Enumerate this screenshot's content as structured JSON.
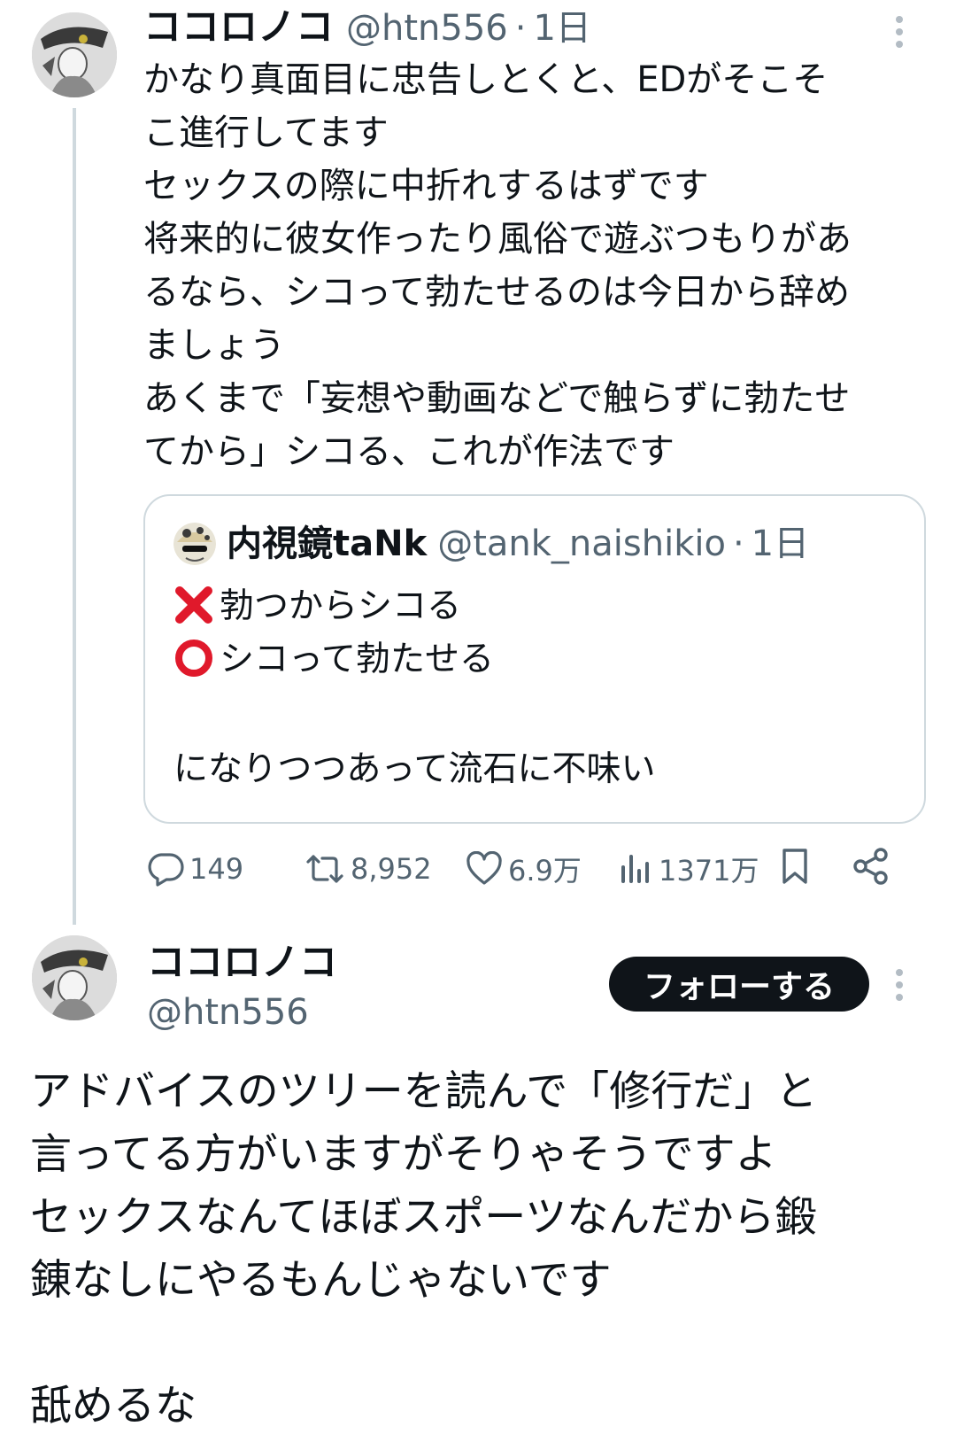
{
  "parent_tweet": {
    "author_name": "ココロノコ",
    "handle": "@htn556",
    "time": "1日",
    "text": "かなり真面目に忠告しとくと、EDがそこそ\nこ進行してます\nセックスの際に中折れするはずです\n将来的に彼女作ったり風俗で遊ぶつもりがあ\nるなら、シコって勃たせるのは今日から辞め\nましょう\nあくまで「妄想や動画などで触らずに勃たせ\nてから」シコる、これが作法です",
    "quote": {
      "author_name": "内視鏡taNk",
      "handle": "@tank_naishikio",
      "time": "1日",
      "line1": "勃つからシコる",
      "line2": "シコって勃たせる",
      "line3": "になりつつあって流石に不味い"
    },
    "actions": {
      "replies": "149",
      "reposts": "8,952",
      "likes": "6.9万",
      "views": "1371万"
    }
  },
  "main_tweet": {
    "author_name": "ココロノコ",
    "handle": "@htn556",
    "follow_label": "フォローする",
    "text": "アドバイスのツリーを読んで「修行だ」と\n言ってる方がいますがそりゃそうですよ\nセックスなんてほぼスポーツなんだから鍛\n錬なしにやるもんじゃないです\n\n舐めるな"
  },
  "icons": {
    "more": "more-vertical-icon",
    "reply": "reply-icon",
    "repost": "repost-icon",
    "like": "heart-icon",
    "views": "views-icon",
    "bookmark": "bookmark-icon",
    "share": "share-icon",
    "cross": "cross-mark-icon",
    "circle": "circle-mark-icon"
  },
  "colors": {
    "text_primary": "#0f1419",
    "text_secondary": "#536471",
    "border": "#cfd9de",
    "mark_red": "#e0192b"
  }
}
